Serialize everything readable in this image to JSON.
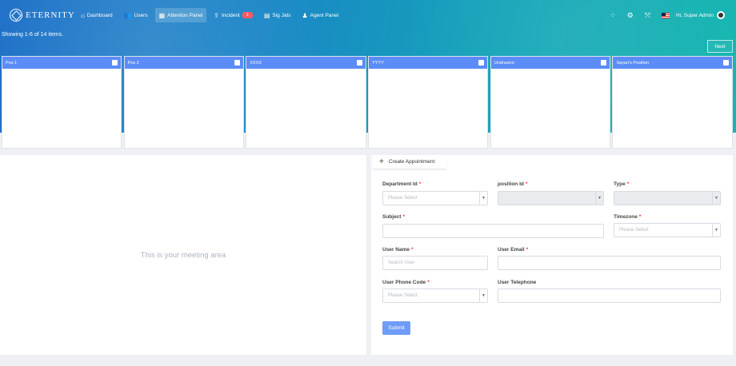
{
  "brand": {
    "name": "ETERNITY"
  },
  "nav": {
    "items": [
      {
        "label": "Dashboard",
        "icon": "home-icon"
      },
      {
        "label": "Users",
        "icon": "users-icon"
      },
      {
        "label": "Attention Panel",
        "icon": "calendar-icon"
      },
      {
        "label": "Incident",
        "icon": "share-icon",
        "badge": "1"
      },
      {
        "label": "Sig Jats",
        "icon": "document-icon"
      },
      {
        "label": "Agent Panel",
        "icon": "agent-icon"
      }
    ],
    "greeting": "Hi, Super Admin"
  },
  "list": {
    "showing": "Showing 1-6 of 14 items.",
    "next_label": "Next",
    "columns": [
      "Pos 1",
      "Pos 2",
      "XXXX",
      "YYYY",
      "Undnuevo",
      "Sayan's Position"
    ]
  },
  "meeting": {
    "placeholder": "This is your meeting area"
  },
  "form": {
    "tab_label": "Create Appointment",
    "department_label": "Department Id",
    "department_placeholder": "Please Select",
    "position_label": "position Id",
    "type_label": "Type",
    "subject_label": "Subject",
    "timezone_label": "Timezone",
    "timezone_placeholder": "Please Select",
    "username_label": "User Name",
    "username_placeholder": "Search User",
    "email_label": "User Email",
    "phone_code_label": "User Phone Code",
    "phone_code_placeholder": "Please Select",
    "telephone_label": "User Telephone",
    "submit_label": "Submit"
  },
  "colors": {
    "accent": "#5b8cf7",
    "submit": "#6f9cf7",
    "required": "#e53935",
    "badge": "#ff5a5f"
  }
}
